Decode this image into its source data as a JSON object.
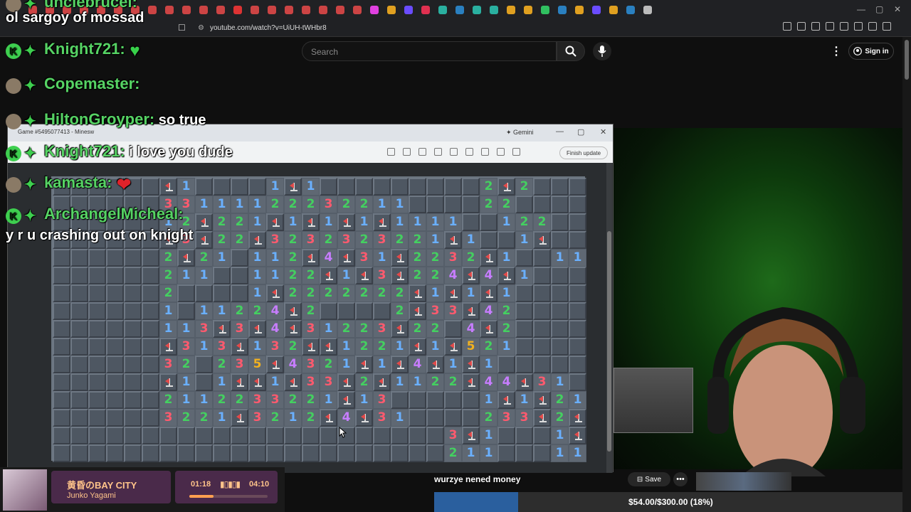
{
  "browser": {
    "url": "youtube.com/watch?v=UiUH-tWHbr8"
  },
  "youtube": {
    "search_placeholder": "Search",
    "sign_in": "Sign in",
    "save": "Save"
  },
  "inner_window": {
    "tab_title": "Game #5495077413 - Minesw",
    "gemini": "Gemini",
    "finish_update": "Finish update"
  },
  "chat": [
    {
      "user": "unclebrucel:",
      "msg": "",
      "badge": "avatar"
    },
    {
      "user": "",
      "msg": "ol sargoy of mossad",
      "badge": "none"
    },
    {
      "user": "Knight721:",
      "msg": "",
      "badge": "k",
      "emote": "green-heart"
    },
    {
      "user": "Copemaster:",
      "msg": "",
      "badge": "avatar"
    },
    {
      "user": "HiltonGroyper:",
      "msg": "so true",
      "badge": "avatar"
    },
    {
      "user": "Knight721:",
      "msg": "i love you dude",
      "badge": "k"
    },
    {
      "user": "kamasta:",
      "msg": "",
      "badge": "avatar",
      "emote": "heart"
    },
    {
      "user": "ArchangelMicheal:",
      "msg": "",
      "badge": "k"
    },
    {
      "user": "",
      "msg": "y r u crashing out on knight",
      "badge": "none"
    }
  ],
  "minesweeper": {
    "rows": [
      "......F1....1F1.........2F2...",
      "......33111122232211....22....",
      "......12F221F1F1F1F1111..122..",
      "......F3F22F3232323221F1..1F..",
      "......2F21.112F4F31F2232F1..11",
      "......211..1122F1F3F224F4F1...",
      "......2....1F2222222F1F1F1....",
      "......1.11224F2....2F33F42....",
      "......113F3F4F31223F22.4F2....",
      "......F313F132FF1221F1F521....",
      "......32.235F4321F1F4F1F1.....",
      "......F1.1FF1F33F2F1122F44F31.",
      "......2112233221F13.....1F1F21",
      "......3221F3212F4F31....233F2F",
      "......................3F1...1F1111",
      "......................211...111..."
    ]
  },
  "music": {
    "title": "黄昏のBAY CITY",
    "artist": "Junko Yagami",
    "current": "01:18",
    "total": "04:10",
    "progress": 0.31
  },
  "donation_message": "wurzye nened money",
  "goal": {
    "text": "$54.00/$300.00 (18%)",
    "fraction": 0.18
  }
}
